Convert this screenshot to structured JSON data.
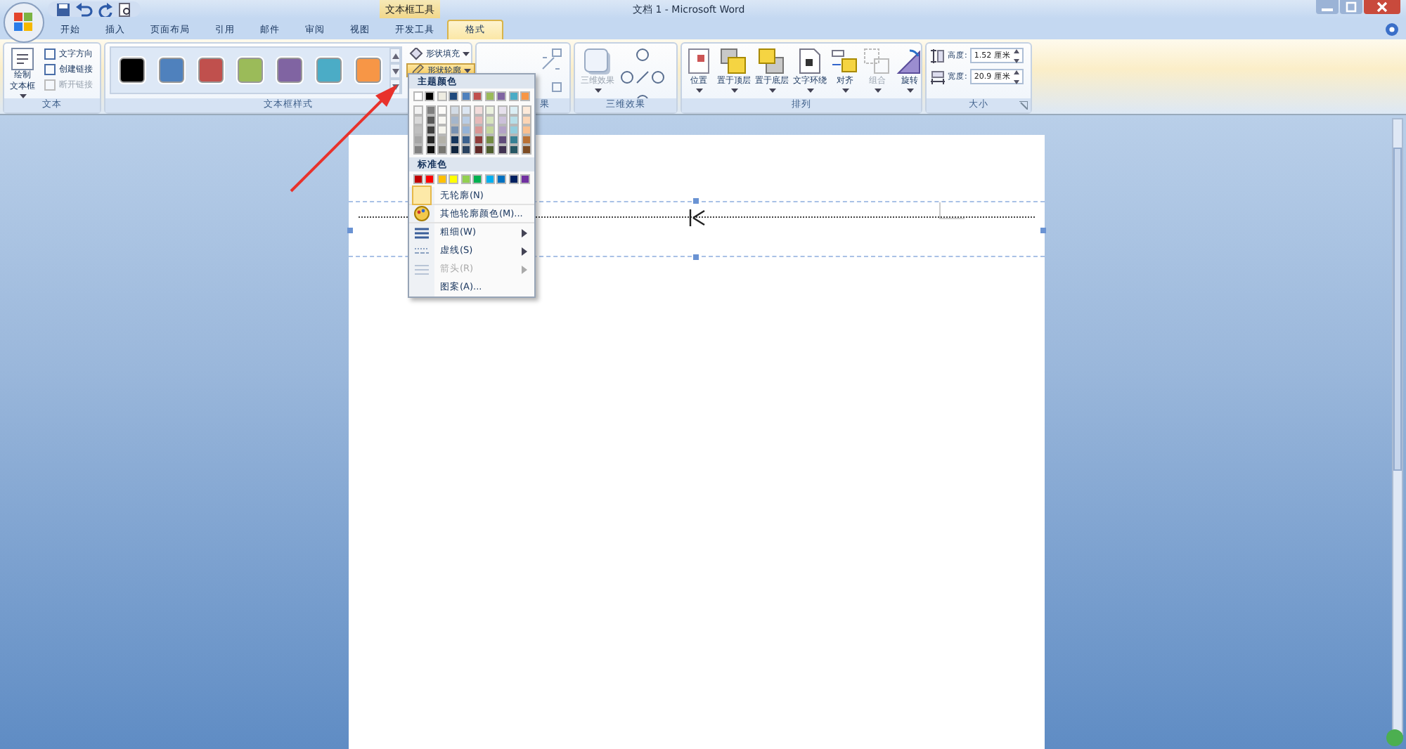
{
  "window": {
    "title": "文档 1 - Microsoft Word",
    "context_tab_label": "文本框工具"
  },
  "tabs": [
    {
      "label": "开始",
      "selected": false
    },
    {
      "label": "插入",
      "selected": false
    },
    {
      "label": "页面布局",
      "selected": false
    },
    {
      "label": "引用",
      "selected": false
    },
    {
      "label": "邮件",
      "selected": false
    },
    {
      "label": "审阅",
      "selected": false
    },
    {
      "label": "视图",
      "selected": false
    },
    {
      "label": "开发工具",
      "selected": false
    },
    {
      "label": "格式",
      "selected": true
    }
  ],
  "text_group": {
    "label": "文本",
    "draw_button": {
      "line1": "绘制",
      "line2": "文本框"
    },
    "items": [
      {
        "label": "文字方向",
        "disabled": false
      },
      {
        "label": "创建链接",
        "disabled": false
      },
      {
        "label": "断开链接",
        "disabled": true
      }
    ]
  },
  "style_group": {
    "label": "文本框样式",
    "swatches": [
      {
        "color": "#000000"
      },
      {
        "color": "#4f81bd"
      },
      {
        "color": "#c0504d"
      },
      {
        "color": "#9bbb59"
      },
      {
        "color": "#8064a2"
      },
      {
        "color": "#4bacc6"
      },
      {
        "color": "#f79646"
      }
    ],
    "fill_button": "形状填充",
    "outline_button": {
      "label": "形状轮廓",
      "on": true
    }
  },
  "shadow_group": {
    "label": "果"
  },
  "three_d_group": {
    "label": "三维效果",
    "button": "三维效果"
  },
  "arrange_group": {
    "label": "排列",
    "buttons": [
      {
        "label": "位置",
        "disabled": false
      },
      {
        "label": "置于顶层",
        "disabled": false
      },
      {
        "label": "置于底层",
        "disabled": false
      },
      {
        "label": "文字环绕",
        "disabled": false
      },
      {
        "label": "对齐",
        "disabled": false
      },
      {
        "label": "组合",
        "disabled": true
      },
      {
        "label": "旋转",
        "disabled": false
      }
    ]
  },
  "size_group": {
    "label": "大小",
    "fields": [
      {
        "label": "高度:",
        "value": "1.52 厘米"
      },
      {
        "label": "宽度:",
        "value": "20.9 厘米"
      }
    ]
  },
  "outline_menu": {
    "theme_heading": "主题颜色",
    "theme_colors": [
      {
        "color": "#ffffff"
      },
      {
        "color": "#000000"
      },
      {
        "color": "#eeece1"
      },
      {
        "color": "#1f497d"
      },
      {
        "color": "#4f81bd"
      },
      {
        "color": "#c0504d"
      },
      {
        "color": "#9bbb59"
      },
      {
        "color": "#8064a2"
      },
      {
        "color": "#4bacc6"
      },
      {
        "color": "#f79646"
      }
    ],
    "standard_heading": "标准色",
    "standard_colors": [
      {
        "color": "#c00000"
      },
      {
        "color": "#ff0000"
      },
      {
        "color": "#ffc000"
      },
      {
        "color": "#ffff00"
      },
      {
        "color": "#92d050"
      },
      {
        "color": "#00b050"
      },
      {
        "color": "#00b0f0"
      },
      {
        "color": "#0070c0"
      },
      {
        "color": "#002060"
      },
      {
        "color": "#7030a0"
      }
    ],
    "items": [
      {
        "kind": "none",
        "label": "无轮廓(N)",
        "disabled": false
      },
      {
        "kind": "more",
        "label": "其他轮廓颜色(M)...",
        "disabled": false
      },
      {
        "kind": "weight",
        "label": "粗细(W)",
        "disabled": false,
        "submenu": true
      },
      {
        "kind": "dash",
        "label": "虚线(S)",
        "disabled": false,
        "submenu": true
      },
      {
        "kind": "arrow",
        "label": "箭头(R)",
        "disabled": true,
        "submenu": true
      },
      {
        "kind": "pattern",
        "label": "图案(A)...",
        "disabled": false
      }
    ]
  }
}
